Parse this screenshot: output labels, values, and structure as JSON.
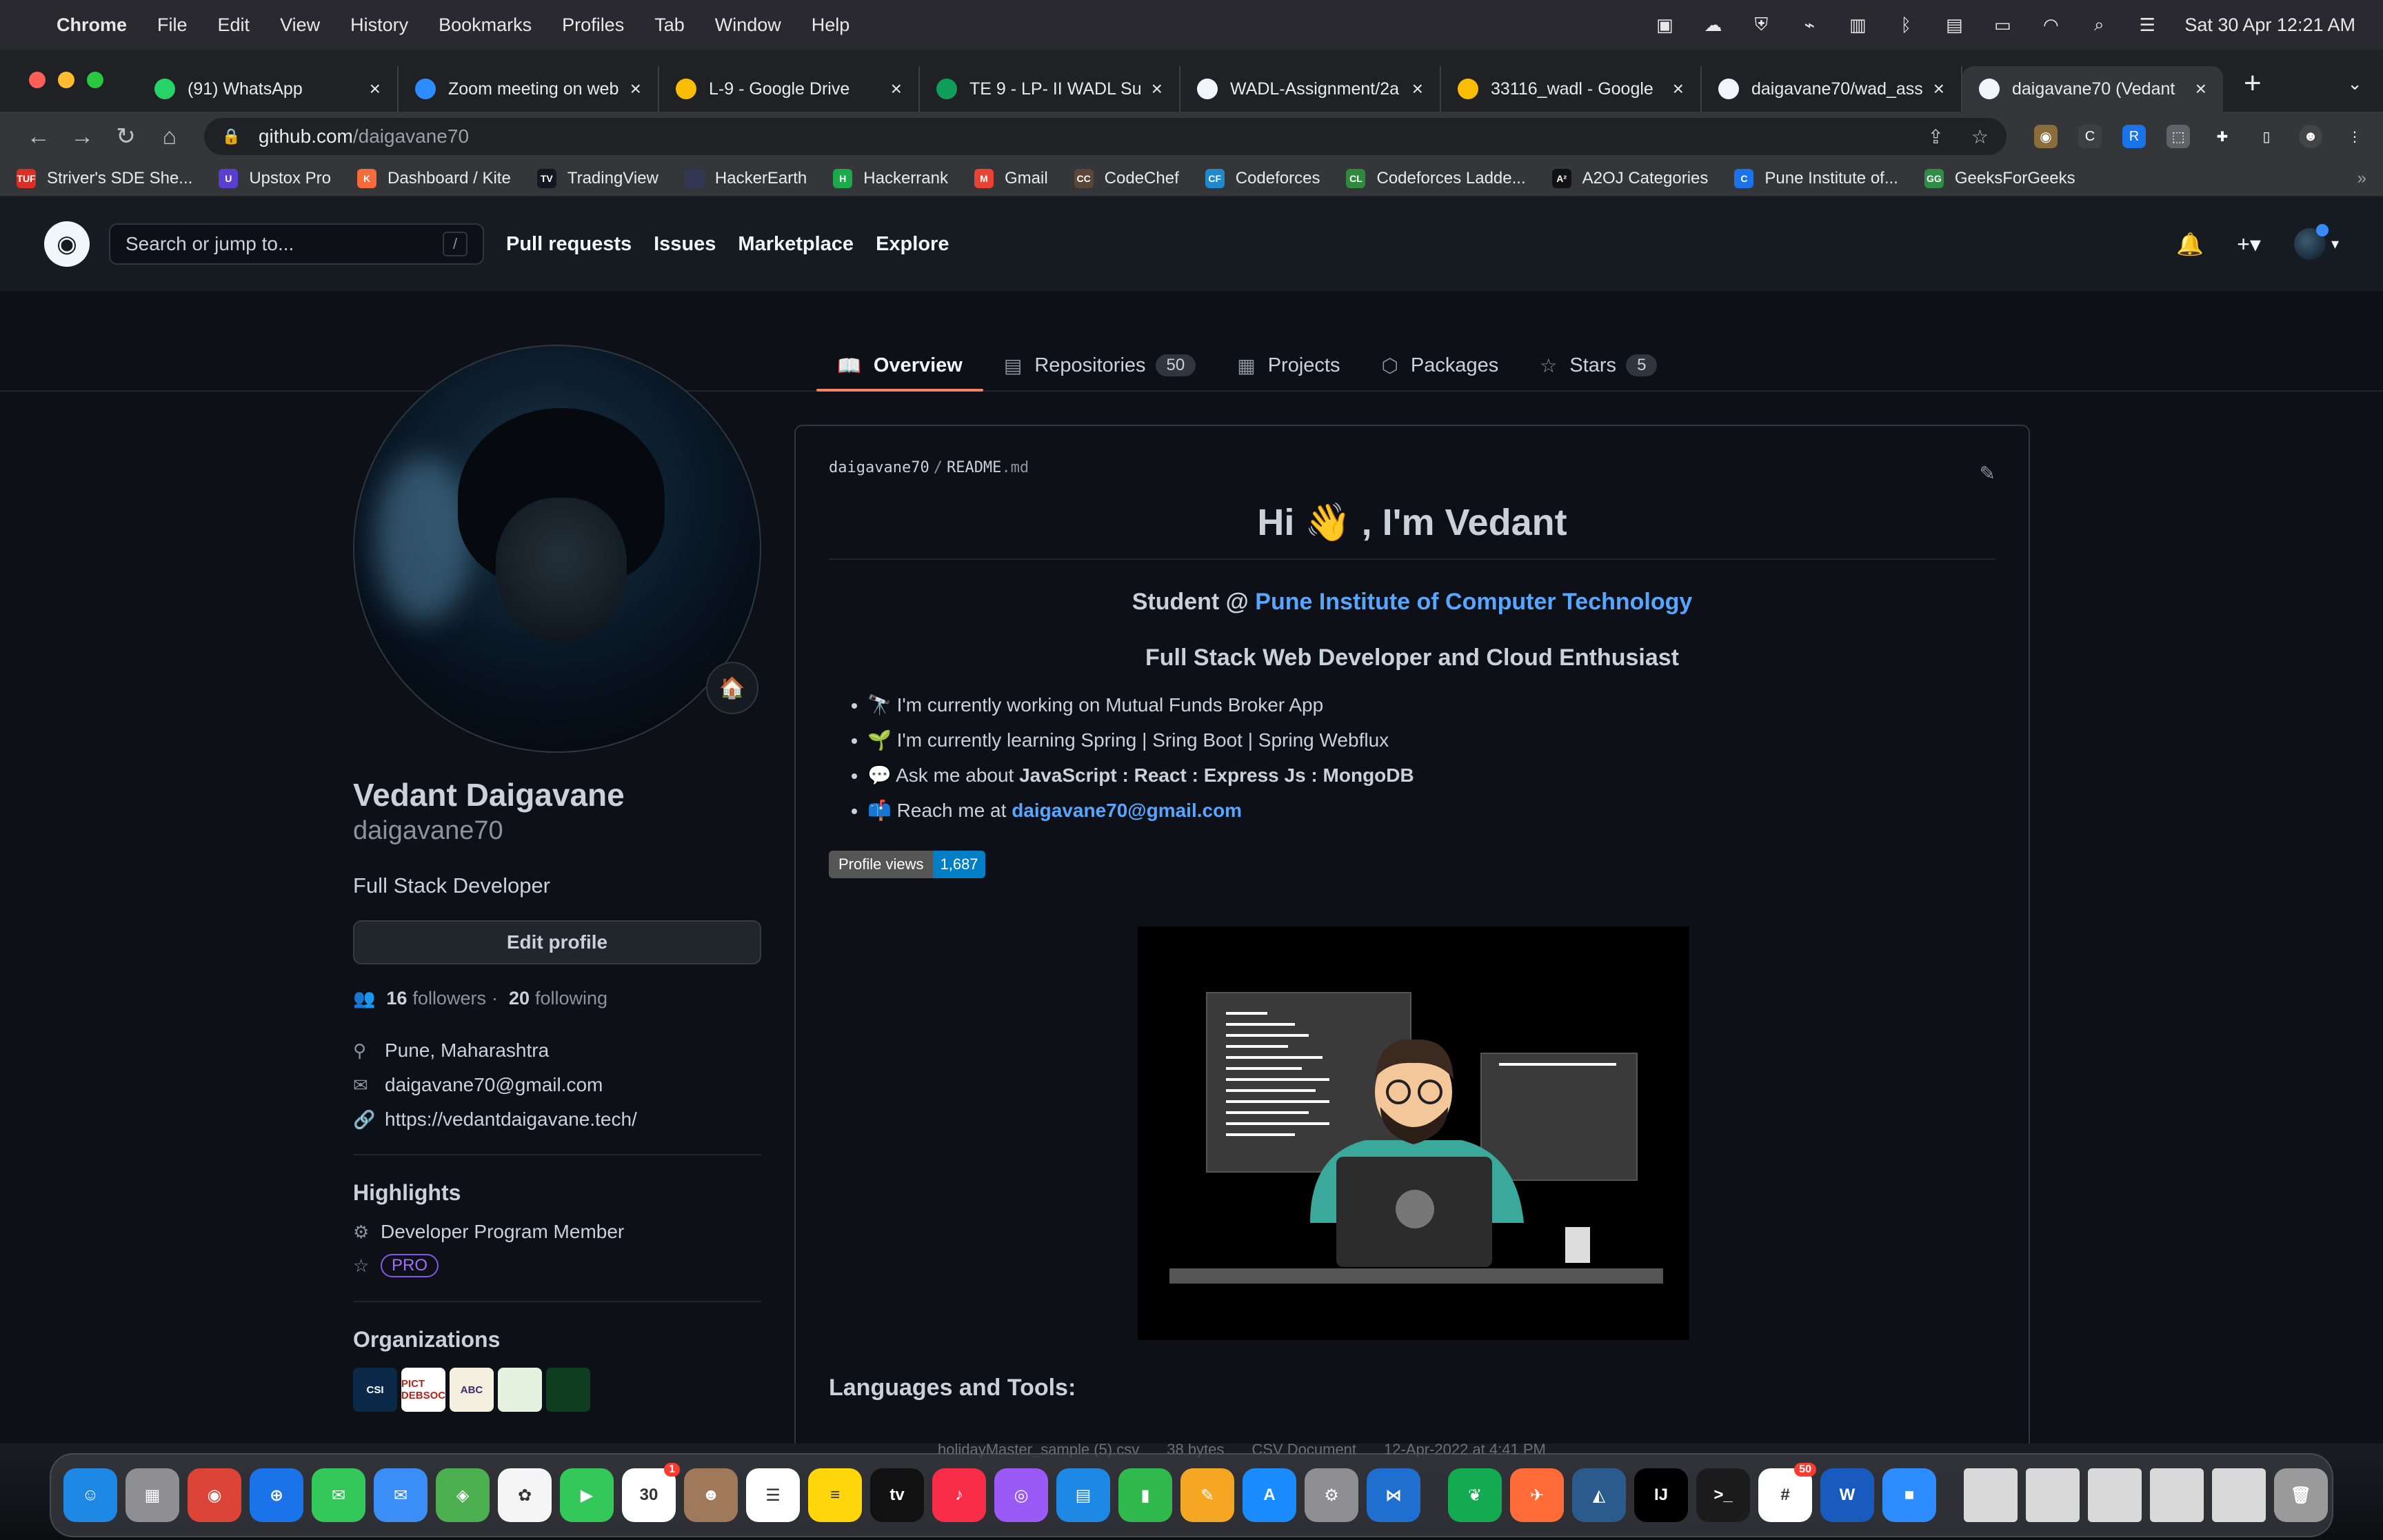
{
  "menubar": {
    "app": "Chrome",
    "items": [
      "File",
      "Edit",
      "View",
      "History",
      "Bookmarks",
      "Profiles",
      "Tab",
      "Window",
      "Help"
    ],
    "clock": "Sat 30 Apr  12:21 AM"
  },
  "tabs": [
    {
      "title": "(91) WhatsApp",
      "icon": "whatsapp-icon",
      "color": "#25d366"
    },
    {
      "title": "Zoom meeting on web",
      "icon": "zoom-icon",
      "color": "#2d8cff"
    },
    {
      "title": "L-9 - Google Drive",
      "icon": "drive-icon",
      "color": "#fbbc04"
    },
    {
      "title": "TE 9 - LP- II WADL Su",
      "icon": "sheets-icon",
      "color": "#0f9d58"
    },
    {
      "title": "WADL-Assignment/2a",
      "icon": "github-icon",
      "color": "#f0f6fc"
    },
    {
      "title": "33116_wadl - Google",
      "icon": "drive-icon",
      "color": "#fbbc04"
    },
    {
      "title": "daigavane70/wad_ass",
      "icon": "github-icon",
      "color": "#f0f6fc"
    },
    {
      "title": "daigavane70 (Vedant",
      "icon": "github-icon",
      "color": "#f0f6fc"
    }
  ],
  "omnibox": {
    "host": "github.com",
    "path": "/daigavane70"
  },
  "bookmarks": [
    {
      "label": "Striver's SDE She...",
      "color": "#d93025",
      "glyph": "TUF"
    },
    {
      "label": "Upstox Pro",
      "color": "#5a3fd1",
      "glyph": "U"
    },
    {
      "label": "Dashboard / Kite",
      "color": "#f46c3a",
      "glyph": "K"
    },
    {
      "label": "TradingView",
      "color": "#131722",
      "glyph": "TV"
    },
    {
      "label": "HackerEarth",
      "color": "#323754",
      "glyph": ""
    },
    {
      "label": "Hackerrank",
      "color": "#1ba94c",
      "glyph": "H"
    },
    {
      "label": "Gmail",
      "color": "#ea4335",
      "glyph": "M"
    },
    {
      "label": "CodeChef",
      "color": "#5b4638",
      "glyph": "CC"
    },
    {
      "label": "Codeforces",
      "color": "#1f8acb",
      "glyph": "CF"
    },
    {
      "label": "Codeforces Ladde...",
      "color": "#2f8a3e",
      "glyph": "CL"
    },
    {
      "label": "A2OJ Categories",
      "color": "#111111",
      "glyph": "A²"
    },
    {
      "label": "Pune Institute of...",
      "color": "#1a73e8",
      "glyph": "C"
    },
    {
      "label": "GeeksForGeeks",
      "color": "#2f8d46",
      "glyph": "GG"
    }
  ],
  "github": {
    "search_placeholder": "Search or jump to...",
    "search_key": "/",
    "nav": [
      "Pull requests",
      "Issues",
      "Marketplace",
      "Explore"
    ]
  },
  "profile_tabs": [
    {
      "label": "Overview",
      "icon": "book-icon",
      "count": "",
      "active": true
    },
    {
      "label": "Repositories",
      "icon": "repo-icon",
      "count": "50",
      "active": false
    },
    {
      "label": "Projects",
      "icon": "project-icon",
      "count": "",
      "active": false
    },
    {
      "label": "Packages",
      "icon": "package-icon",
      "count": "",
      "active": false
    },
    {
      "label": "Stars",
      "icon": "star-icon",
      "count": "5",
      "active": false
    }
  ],
  "profile": {
    "name": "Vedant Daigavane",
    "login": "daigavane70",
    "bio": "Full Stack Developer",
    "edit_label": "Edit profile",
    "followers_count": "16",
    "followers_label": "followers",
    "separator": "·",
    "following_count": "20",
    "following_label": "following",
    "location": "Pune, Maharashtra",
    "email": "daigavane70@gmail.com",
    "website": "https://vedantdaigavane.tech/",
    "highlights_title": "Highlights",
    "highlight_program": "Developer Program Member",
    "pro_label": "PRO",
    "orgs_title": "Organizations",
    "orgs": [
      {
        "label": "CSI",
        "bg": "#0b2a4a",
        "fg": "#ffffff"
      },
      {
        "label": "PICT DEBSOC",
        "bg": "#ffffff",
        "fg": "#b3261e"
      },
      {
        "label": "ABC",
        "bg": "#f5efe0",
        "fg": "#3b2f6b"
      },
      {
        "label": "",
        "bg": "#e5f2e0",
        "fg": "#2f8a3e"
      },
      {
        "label": "",
        "bg": "#0f3d1f",
        "fg": "#33cc66"
      }
    ]
  },
  "readme": {
    "owner": "daigavane70",
    "slash": "/",
    "file": "README",
    "ext": ".md",
    "heading": "Hi 👋 , I'm Vedant",
    "student_prefix": "Student @ ",
    "college": "Pune Institute of Computer Technology",
    "tagline": "Full Stack Web Developer and Cloud Enthusiast",
    "bullets": [
      {
        "emoji": "🔭",
        "text": "I'm currently working on Mutual Funds Broker App"
      },
      {
        "emoji": "🌱",
        "text": "I'm currently learning Spring | Sring Boot | Spring Webflux"
      },
      {
        "emoji": "💬",
        "prefix": "Ask me about ",
        "bold": "JavaScript : React : Express Js : MongoDB"
      },
      {
        "emoji": "📫",
        "prefix": "Reach me at ",
        "mail": "daigavane70@gmail.com"
      }
    ],
    "views_label": "Profile views",
    "views_value": "1,687",
    "languages_title": "Languages and Tools:"
  },
  "dock": [
    {
      "name": "finder",
      "color": "#1e88e5",
      "glyph": "☺"
    },
    {
      "name": "launchpad",
      "color": "#8e8e93",
      "glyph": "▦"
    },
    {
      "name": "chrome",
      "color": "#db4437",
      "glyph": "◉"
    },
    {
      "name": "safari",
      "color": "#1a73e8",
      "glyph": "⊕"
    },
    {
      "name": "messages",
      "color": "#34c759",
      "glyph": "✉"
    },
    {
      "name": "mail",
      "color": "#3a8ef6",
      "glyph": "✉"
    },
    {
      "name": "maps",
      "color": "#4caf50",
      "glyph": "◈"
    },
    {
      "name": "photos",
      "color": "#f5f5f5",
      "glyph": "✿"
    },
    {
      "name": "facetime",
      "color": "#34c759",
      "glyph": "▶"
    },
    {
      "name": "calendar",
      "color": "#ffffff",
      "glyph": "30",
      "badge": "1"
    },
    {
      "name": "contacts",
      "color": "#a0785a",
      "glyph": "☻"
    },
    {
      "name": "reminders",
      "color": "#ffffff",
      "glyph": "☰"
    },
    {
      "name": "notes",
      "color": "#ffd60a",
      "glyph": "≡"
    },
    {
      "name": "tv",
      "color": "#111111",
      "glyph": "tv"
    },
    {
      "name": "music",
      "color": "#fa2d48",
      "glyph": "♪"
    },
    {
      "name": "podcasts",
      "color": "#9b59f5",
      "glyph": "◎"
    },
    {
      "name": "keynote",
      "color": "#1e88e5",
      "glyph": "▤"
    },
    {
      "name": "numbers",
      "color": "#30b94d",
      "glyph": "▮"
    },
    {
      "name": "pages",
      "color": "#f5a623",
      "glyph": "✎"
    },
    {
      "name": "app-store",
      "color": "#1a8cff",
      "glyph": "A"
    },
    {
      "name": "settings",
      "color": "#8e8e93",
      "glyph": "⚙"
    },
    {
      "name": "vscode",
      "color": "#1e6fd0",
      "glyph": "⋈"
    },
    {
      "name": "mongodb-compass",
      "color": "#13aa52",
      "glyph": "❦"
    },
    {
      "name": "postman",
      "color": "#ff6c37",
      "glyph": "✈"
    },
    {
      "name": "mysql-workbench",
      "color": "#2a5b8c",
      "glyph": "◭"
    },
    {
      "name": "intellij",
      "color": "#000000",
      "glyph": "IJ"
    },
    {
      "name": "terminal",
      "color": "#1c1c1c",
      "glyph": ">_"
    },
    {
      "name": "slack",
      "color": "#ffffff",
      "glyph": "#",
      "badge": "50"
    },
    {
      "name": "word",
      "color": "#185abd",
      "glyph": "W"
    },
    {
      "name": "zoom",
      "color": "#2d8cff",
      "glyph": "■"
    }
  ],
  "downloads": [
    "holidayMaster_sample (5).csv",
    "38 bytes",
    "CSV Document",
    "12-Apr-2022 at 4:41 PM"
  ]
}
